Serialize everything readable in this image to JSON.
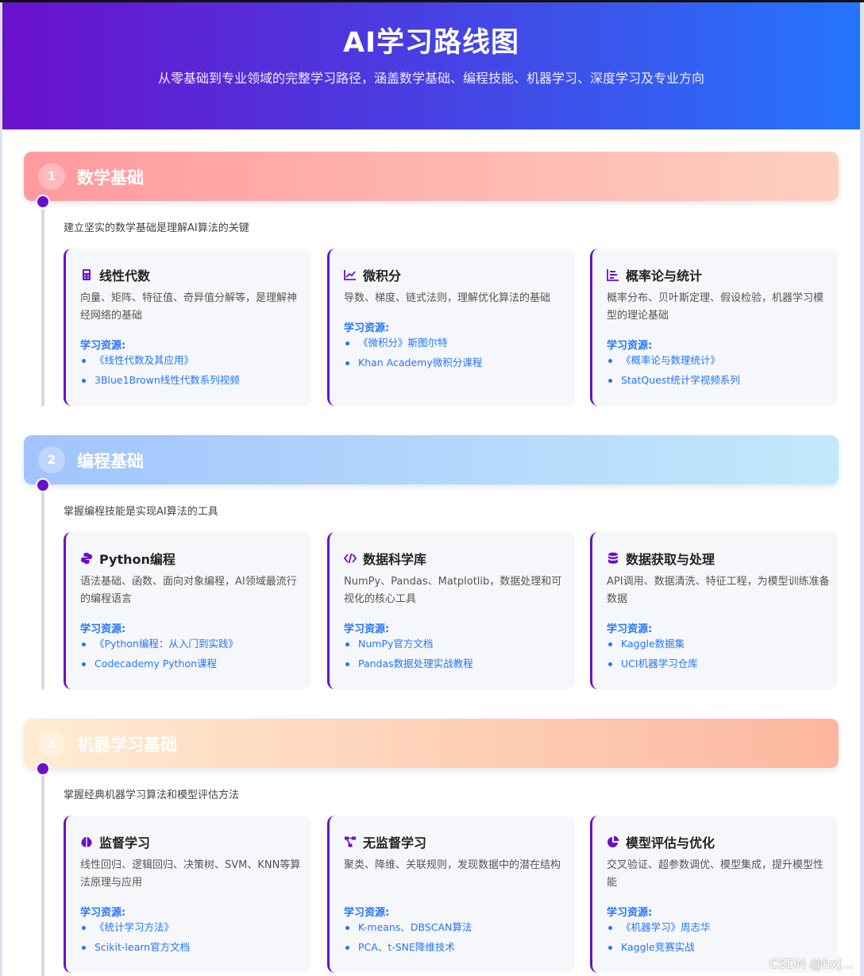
{
  "header": {
    "title": "AI学习路线图",
    "subtitle": "从零基础到专业领域的完整学习路径，涵盖数学基础、编程技能、机器学习、深度学习及专业方向"
  },
  "colors": {
    "accent": "#6a11cb",
    "link": "#2575fc",
    "section1": [
      "#ff9a9e",
      "#fecfc0"
    ],
    "section2": [
      "#a1c4fd",
      "#c2e9fb"
    ],
    "section3": [
      "#ffecd2",
      "#fcb69f"
    ]
  },
  "resources_label": "学习资源:",
  "sections": [
    {
      "number": "1",
      "title": "数学基础",
      "description": "建立坚实的数学基础是理解AI算法的关键",
      "cards": [
        {
          "icon": "calculator-icon",
          "title": "线性代数",
          "description": "向量、矩阵、特征值、奇异值分解等，是理解神经网络的基础",
          "resources": [
            "《线性代数及其应用》",
            "3Blue1Brown线性代数系列视频"
          ]
        },
        {
          "icon": "line-chart-icon",
          "title": "微积分",
          "description": "导数、梯度、链式法则，理解优化算法的基础",
          "resources": [
            "《微积分》斯图尔特",
            "Khan Academy微积分课程"
          ]
        },
        {
          "icon": "bar-chart-icon",
          "title": "概率论与统计",
          "description": "概率分布、贝叶斯定理、假设检验，机器学习模型的理论基础",
          "resources": [
            "《概率论与数理统计》",
            "StatQuest统计学视频系列"
          ]
        }
      ]
    },
    {
      "number": "2",
      "title": "编程基础",
      "description": "掌握编程技能是实现AI算法的工具",
      "cards": [
        {
          "icon": "python-icon",
          "title": "Python编程",
          "description": "语法基础、函数、面向对象编程，AI领域最流行的编程语言",
          "resources": [
            "《Python编程：从入门到实践》",
            "Codecademy Python课程"
          ]
        },
        {
          "icon": "code-icon",
          "title": "数据科学库",
          "description": "NumPy、Pandas、Matplotlib，数据处理和可视化的核心工具",
          "resources": [
            "NumPy官方文档",
            "Pandas数据处理实战教程"
          ]
        },
        {
          "icon": "database-icon",
          "title": "数据获取与处理",
          "description": "API调用、数据清洗、特征工程，为模型训练准备数据",
          "resources": [
            "Kaggle数据集",
            "UCI机器学习仓库"
          ]
        }
      ]
    },
    {
      "number": "3",
      "title": "机器学习基础",
      "description": "掌握经典机器学习算法和模型评估方法",
      "cards": [
        {
          "icon": "brain-icon",
          "title": "监督学习",
          "description": "线性回归、逻辑回归、决策树、SVM、KNN等算法原理与应用",
          "resources": [
            "《统计学习方法》",
            "Scikit-learn官方文档"
          ]
        },
        {
          "icon": "network-icon",
          "title": "无监督学习",
          "description": "聚类、降维、关联规则，发现数据中的潜在结构",
          "resources": [
            "K-means、DBSCAN算法",
            "PCA、t-SNE降维技术"
          ]
        },
        {
          "icon": "pie-chart-icon",
          "title": "模型评估与优化",
          "description": "交叉验证、超参数调优、模型集成，提升模型性能",
          "resources": [
            "《机器学习》周志华",
            "Kaggle竞赛实战"
          ]
        }
      ]
    }
  ],
  "watermark": "CSDN @hxj..."
}
